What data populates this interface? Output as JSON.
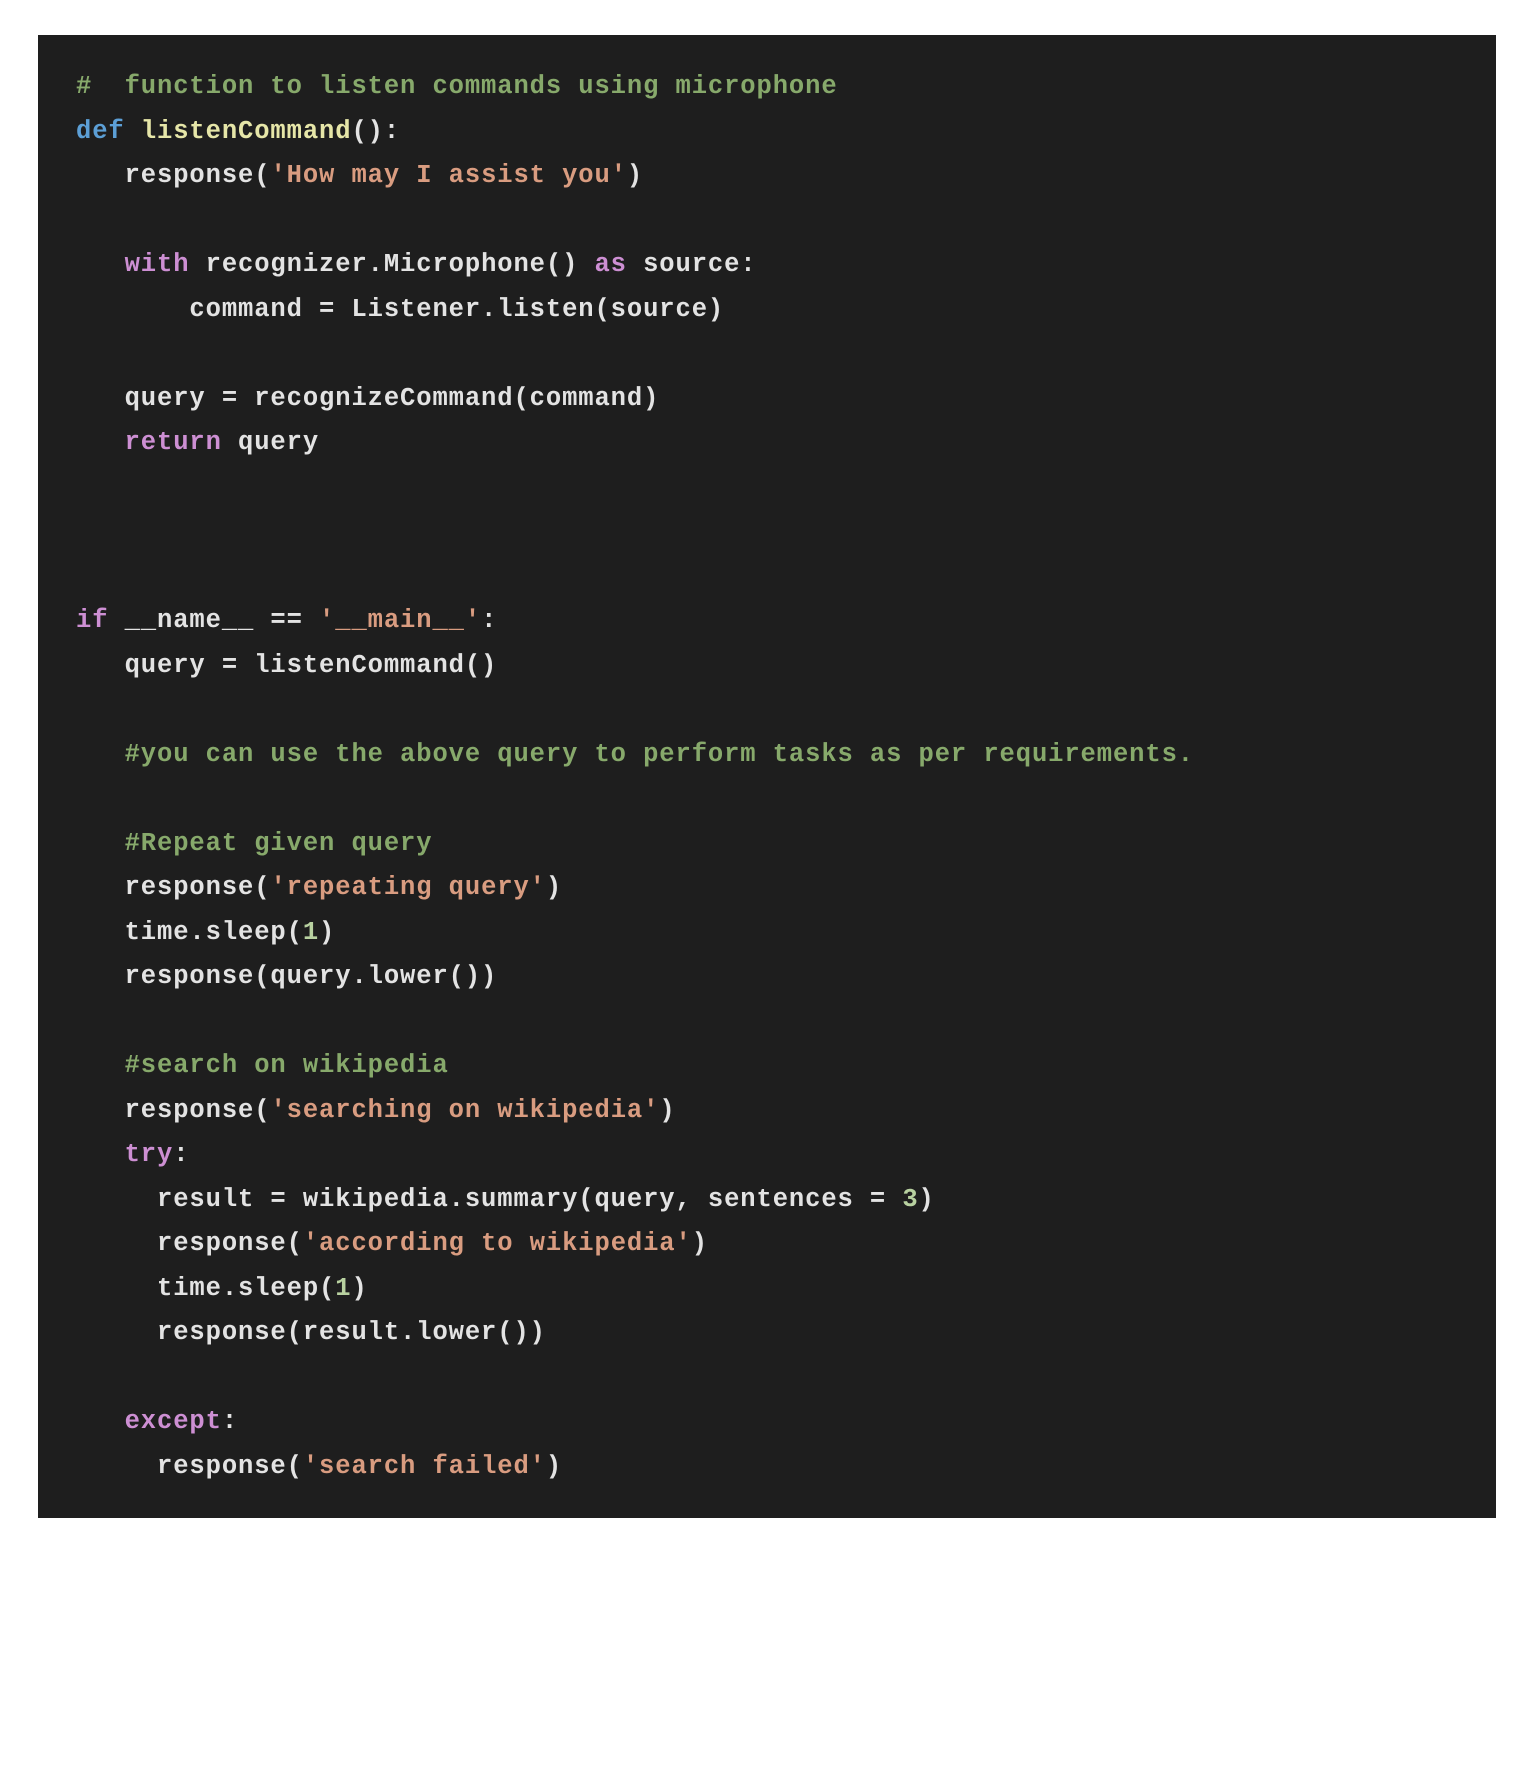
{
  "editor": {
    "language": "Python",
    "theme": "dark",
    "background_color": "#1e1e1e",
    "page_background_color": "#ffffff",
    "colors": {
      "comment": "#87a96b",
      "keyword": "#cd8fd3",
      "def_keyword": "#5c9fd6",
      "function_name": "#e6e6a8",
      "string": "#d99c80",
      "number": "#b8d1a0",
      "plain": "#e3e3e3"
    }
  },
  "code": {
    "lines": [
      {
        "id": "l1",
        "tokens": [
          {
            "t": "#  function to listen commands using microphone",
            "c": "comment"
          }
        ]
      },
      {
        "id": "l2",
        "tokens": [
          {
            "t": "def ",
            "c": "def"
          },
          {
            "t": "listenCommand",
            "c": "fname"
          },
          {
            "t": "():",
            "c": "plain"
          }
        ]
      },
      {
        "id": "l3",
        "tokens": [
          {
            "t": "   response(",
            "c": "plain"
          },
          {
            "t": "'How may I assist you'",
            "c": "string"
          },
          {
            "t": ")",
            "c": "plain"
          }
        ]
      },
      {
        "id": "l4",
        "tokens": [
          {
            "t": "",
            "c": "plain"
          }
        ]
      },
      {
        "id": "l5",
        "tokens": [
          {
            "t": "   ",
            "c": "plain"
          },
          {
            "t": "with",
            "c": "keyword"
          },
          {
            "t": " recognizer.Microphone() ",
            "c": "plain"
          },
          {
            "t": "as",
            "c": "keyword"
          },
          {
            "t": " source:",
            "c": "plain"
          }
        ]
      },
      {
        "id": "l6",
        "tokens": [
          {
            "t": "       command = Listener.listen(source)",
            "c": "plain"
          }
        ]
      },
      {
        "id": "l7",
        "tokens": [
          {
            "t": "",
            "c": "plain"
          }
        ]
      },
      {
        "id": "l8",
        "tokens": [
          {
            "t": "   query = recognizeCommand(command)",
            "c": "plain"
          }
        ]
      },
      {
        "id": "l9",
        "tokens": [
          {
            "t": "   ",
            "c": "plain"
          },
          {
            "t": "return",
            "c": "keyword"
          },
          {
            "t": " query",
            "c": "plain"
          }
        ]
      },
      {
        "id": "l10",
        "tokens": [
          {
            "t": "",
            "c": "plain"
          }
        ]
      },
      {
        "id": "l11",
        "tokens": [
          {
            "t": "",
            "c": "plain"
          }
        ]
      },
      {
        "id": "l12",
        "tokens": [
          {
            "t": "",
            "c": "plain"
          }
        ]
      },
      {
        "id": "l13",
        "tokens": [
          {
            "t": "if",
            "c": "keyword"
          },
          {
            "t": " __name__ == ",
            "c": "plain"
          },
          {
            "t": "'__main__'",
            "c": "string"
          },
          {
            "t": ":",
            "c": "plain"
          }
        ]
      },
      {
        "id": "l14",
        "tokens": [
          {
            "t": "   query = listenCommand()",
            "c": "plain"
          }
        ]
      },
      {
        "id": "l15",
        "tokens": [
          {
            "t": "",
            "c": "plain"
          }
        ]
      },
      {
        "id": "l16",
        "tokens": [
          {
            "t": "   ",
            "c": "plain"
          },
          {
            "t": "#you can use the above query to perform tasks as per requirements.",
            "c": "comment"
          }
        ]
      },
      {
        "id": "l17",
        "tokens": [
          {
            "t": "",
            "c": "plain"
          }
        ]
      },
      {
        "id": "l18",
        "tokens": [
          {
            "t": "   ",
            "c": "plain"
          },
          {
            "t": "#Repeat given query",
            "c": "comment"
          }
        ]
      },
      {
        "id": "l19",
        "tokens": [
          {
            "t": "   response(",
            "c": "plain"
          },
          {
            "t": "'repeating query'",
            "c": "string"
          },
          {
            "t": ")",
            "c": "plain"
          }
        ]
      },
      {
        "id": "l20",
        "tokens": [
          {
            "t": "   time.sleep(",
            "c": "plain"
          },
          {
            "t": "1",
            "c": "number"
          },
          {
            "t": ")",
            "c": "plain"
          }
        ]
      },
      {
        "id": "l21",
        "tokens": [
          {
            "t": "   response(query.lower())",
            "c": "plain"
          }
        ]
      },
      {
        "id": "l22",
        "tokens": [
          {
            "t": "",
            "c": "plain"
          }
        ]
      },
      {
        "id": "l23",
        "tokens": [
          {
            "t": "   ",
            "c": "plain"
          },
          {
            "t": "#search on wikipedia",
            "c": "comment"
          }
        ]
      },
      {
        "id": "l24",
        "tokens": [
          {
            "t": "   response(",
            "c": "plain"
          },
          {
            "t": "'searching on wikipedia'",
            "c": "string"
          },
          {
            "t": ")",
            "c": "plain"
          }
        ]
      },
      {
        "id": "l25",
        "tokens": [
          {
            "t": "   ",
            "c": "plain"
          },
          {
            "t": "try",
            "c": "keyword"
          },
          {
            "t": ":",
            "c": "plain"
          }
        ]
      },
      {
        "id": "l26",
        "tokens": [
          {
            "t": "     result = wikipedia.summary(query, sentences = ",
            "c": "plain"
          },
          {
            "t": "3",
            "c": "number"
          },
          {
            "t": ")",
            "c": "plain"
          }
        ]
      },
      {
        "id": "l27",
        "tokens": [
          {
            "t": "     response(",
            "c": "plain"
          },
          {
            "t": "'according to wikipedia'",
            "c": "string"
          },
          {
            "t": ")",
            "c": "plain"
          }
        ]
      },
      {
        "id": "l28",
        "tokens": [
          {
            "t": "     time.sleep(",
            "c": "plain"
          },
          {
            "t": "1",
            "c": "number"
          },
          {
            "t": ")",
            "c": "plain"
          }
        ]
      },
      {
        "id": "l29",
        "tokens": [
          {
            "t": "     response(result.lower())",
            "c": "plain"
          }
        ]
      },
      {
        "id": "l30",
        "tokens": [
          {
            "t": "",
            "c": "plain"
          }
        ]
      },
      {
        "id": "l31",
        "tokens": [
          {
            "t": "   ",
            "c": "plain"
          },
          {
            "t": "except",
            "c": "keyword"
          },
          {
            "t": ":",
            "c": "plain"
          }
        ]
      },
      {
        "id": "l32",
        "tokens": [
          {
            "t": "     response(",
            "c": "plain"
          },
          {
            "t": "'search failed'",
            "c": "string"
          },
          {
            "t": ")",
            "c": "plain"
          }
        ]
      }
    ]
  }
}
